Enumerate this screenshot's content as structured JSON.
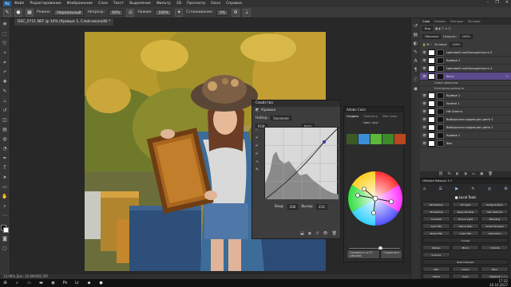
{
  "menubar": {
    "logo": "Ps",
    "items": [
      "Файл",
      "Редактирование",
      "Изображение",
      "Слои",
      "Текст",
      "Выделение",
      "Фильтр",
      "3D",
      "Просмотр",
      "Окно",
      "Справка"
    ],
    "window_controls": [
      "–",
      "❐",
      "✕"
    ]
  },
  "options_bar": {
    "mode_label": "Режим:",
    "mode_value": "Нормальный",
    "opacity_label": "Непрозр.:",
    "opacity_value": "60%",
    "pressure_label": "Нажим:",
    "pressure_value": "100%",
    "smooth_label": "Сглаживание:",
    "smooth_value": "0%"
  },
  "document_tab": {
    "title": "DSC_0711.NEF @ 34% (Кривые 1, Слой-маска/8) *"
  },
  "status_bar": {
    "text": "33,98%    Док: 34,6M/462,5M"
  },
  "properties": {
    "title": "Свойства",
    "layer_type": "Кривые",
    "preset_label": "Набор:",
    "preset_value": "Заказная",
    "channel_value": "RGB",
    "auto_label": "Авто",
    "input_label": "Вход:",
    "input_value": "206",
    "output_label": "Выход:",
    "output_value": "212"
  },
  "adobe_color": {
    "title": "Adobe Color",
    "tabs": [
      "Создать",
      "Просмотр",
      "Мои темы"
    ],
    "subtitle": "Цвет. круг",
    "swatches": [
      "#3d5a26",
      "#3a8fd6",
      "#5bb83a",
      "#3b8a2c",
      "#b9481e"
    ],
    "footer_left": "Сохранить в CC Libraries",
    "footer_right": "Сохранить",
    "brightness": 0.62
  },
  "layers": {
    "tabs": [
      "Слои",
      "Каналы",
      "Контуры",
      "История"
    ],
    "kind_label": "Вид",
    "blend_value": "Обычные",
    "opacity_label": "Непрозр.:",
    "opacity_value": "100%",
    "fill_label": "Заливка:",
    "fill_value": "100%",
    "items": [
      {
        "name": "Цветовой тон/Насыщенность 5",
        "selected": false,
        "sub": false,
        "fx": ""
      },
      {
        "name": "Кривые 3",
        "selected": false,
        "sub": false,
        "fx": ""
      },
      {
        "name": "Цветовой тон/Насыщенность 4",
        "selected": false,
        "sub": false,
        "fx": ""
      },
      {
        "name": "Фото",
        "selected": true,
        "sub": false,
        "fx": "fx"
      },
      {
        "name": "Смарт-фильтры",
        "selected": false,
        "sub": true,
        "fx": ""
      },
      {
        "name": "Контурная резкость",
        "selected": false,
        "sub": true,
        "fx": ""
      },
      {
        "name": "Кривые 2",
        "selected": false,
        "sub": false,
        "fx": ""
      },
      {
        "name": "Уровни 1",
        "selected": false,
        "sub": false,
        "fx": ""
      },
      {
        "name": "НФ Осветл.",
        "selected": false,
        "sub": false,
        "fx": ""
      },
      {
        "name": "Выборочная коррекция цвета 2",
        "selected": false,
        "sub": false,
        "fx": ""
      },
      {
        "name": "Выборочная коррекция цвета 1",
        "selected": false,
        "sub": false,
        "fx": ""
      },
      {
        "name": "Кривые 1",
        "selected": false,
        "sub": false,
        "fx": ""
      },
      {
        "name": "Фон",
        "selected": false,
        "sub": false,
        "fx": ""
      }
    ],
    "footer_icons": [
      "⛓",
      "fx",
      "◐",
      "◑",
      "▭",
      "▣",
      "🗑"
    ]
  },
  "ultimate": {
    "title": "Ultimate Retouch 3.7",
    "local_title": "■ Local Tools",
    "buttons": [
      "DR Restore",
      "Fill Light",
      "Dodge & Burn",
      "3D Restore",
      "Deep Shadow",
      "Skin Retouch",
      "Contrast",
      "Tone & Light",
      "Blending",
      "Auto HSL",
      "Hair & Skin",
      "Smart Sharpen",
      "Sharp HSL",
      "Color HSL",
      "Saturation"
    ],
    "curve_label": "Curves",
    "btns2": [
      "Darken",
      "Mirror",
      "3 Points",
      "S Curve"
    ],
    "rgb_label": "RGB Channels",
    "btns3": [
      "Red",
      "Green",
      "Blue",
      "Yellow",
      "Cyan",
      "Magenta"
    ],
    "version": "© Pro Add-Ons"
  },
  "taskbar": {
    "time": "17:32",
    "date": "20.10.2017"
  }
}
